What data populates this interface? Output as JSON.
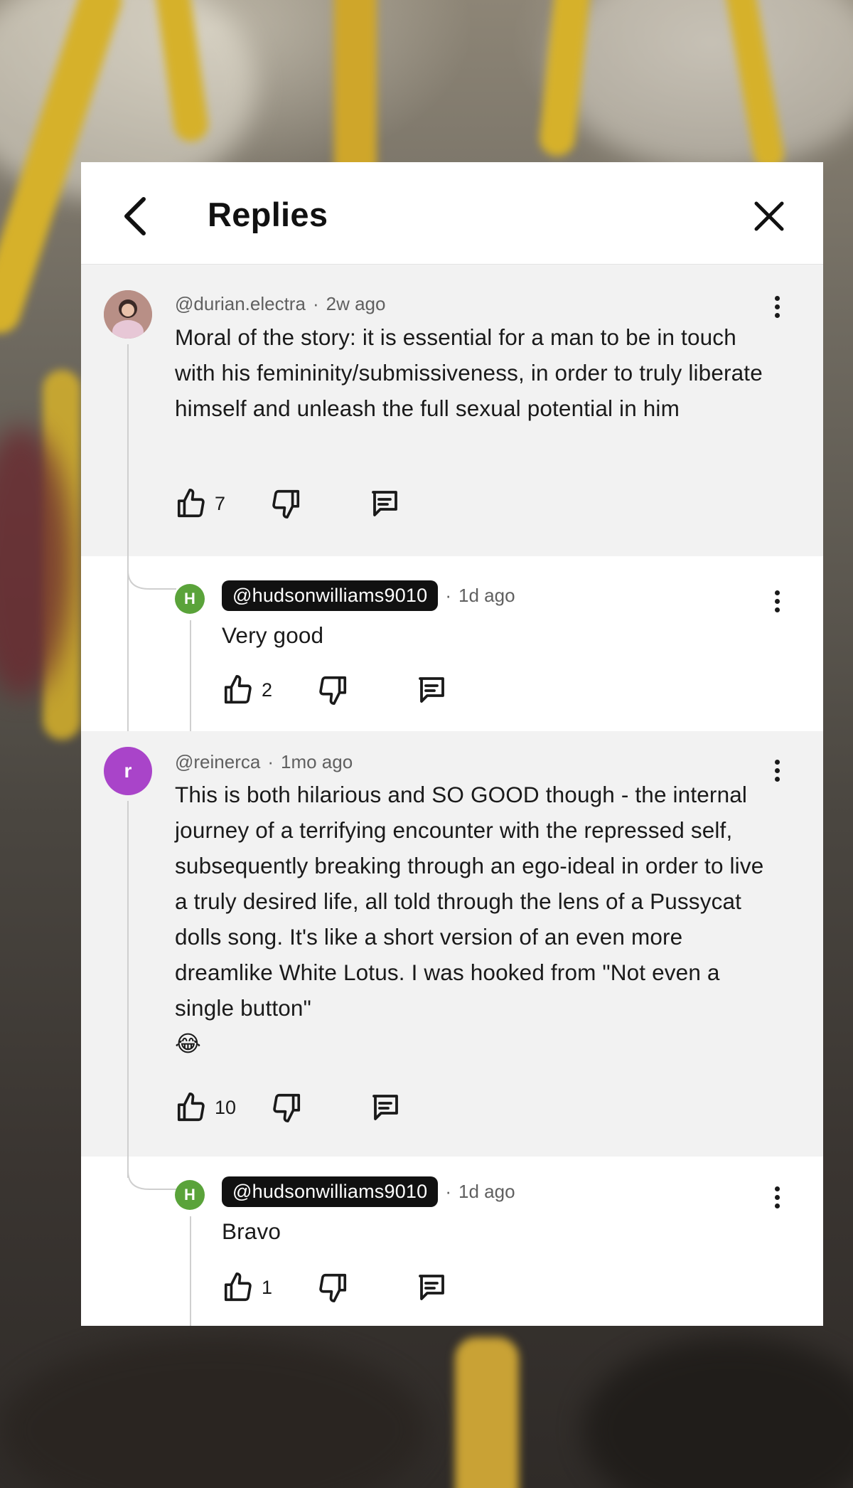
{
  "header": {
    "title": "Replies"
  },
  "comments": [
    {
      "handle": "@durian.electra",
      "time": "2w ago",
      "text": "Moral of the story: it is essential for a man to be in touch with his femininity/submissiveness, in order to truly liberate himself and unleash the full sexual potential in him",
      "likes": "7",
      "avatar_color": "#c9a9a0"
    },
    {
      "handle": "@hudsonwilliams9010",
      "time": "1d ago",
      "text": "Very good",
      "likes": "2",
      "avatar_letter": "H",
      "avatar_color": "#5aa33a"
    },
    {
      "handle": "@reinerca",
      "time": "1mo ago",
      "text": "This is both hilarious and SO GOOD though - the internal journey of a terrifying encounter with the repressed self, subsequently breaking through an ego-ideal in order to live a truly desired life, all told through the lens of a Pussycat dolls song. It's like a short version of an even more dreamlike White Lotus. I was hooked from \"Not even a single button\"",
      "emoji": "😂",
      "likes": "10",
      "avatar_letter": "r",
      "avatar_color": "#a944c9"
    },
    {
      "handle": "@hudsonwilliams9010",
      "time": "1d ago",
      "text": "Bravo",
      "likes": "1",
      "avatar_letter": "H",
      "avatar_color": "#5aa33a"
    }
  ],
  "separator": "·",
  "icons": [
    "back-icon",
    "close-icon",
    "thumbs-up-icon",
    "thumbs-down-icon",
    "reply-icon",
    "more-vert-icon"
  ]
}
